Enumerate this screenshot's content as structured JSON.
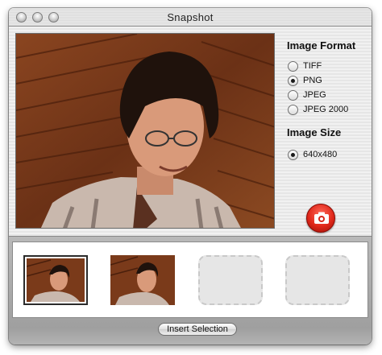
{
  "window": {
    "title": "Snapshot"
  },
  "format": {
    "heading": "Image Format",
    "options": [
      {
        "label": "TIFF",
        "selected": false
      },
      {
        "label": "PNG",
        "selected": true
      },
      {
        "label": "JPEG",
        "selected": false
      },
      {
        "label": "JPEG 2000",
        "selected": false
      }
    ]
  },
  "size": {
    "heading": "Image Size",
    "options": [
      {
        "label": "640x480",
        "selected": true
      }
    ]
  },
  "thumbnails": [
    {
      "state": "selected"
    },
    {
      "state": "filled"
    },
    {
      "state": "empty"
    },
    {
      "state": "empty"
    }
  ],
  "buttons": {
    "insert_label": "Insert Selection",
    "snapshot_icon": "camera-icon"
  },
  "colors": {
    "snapshot_button": "#e0281a",
    "window_chrome": "#d8d8d8"
  }
}
